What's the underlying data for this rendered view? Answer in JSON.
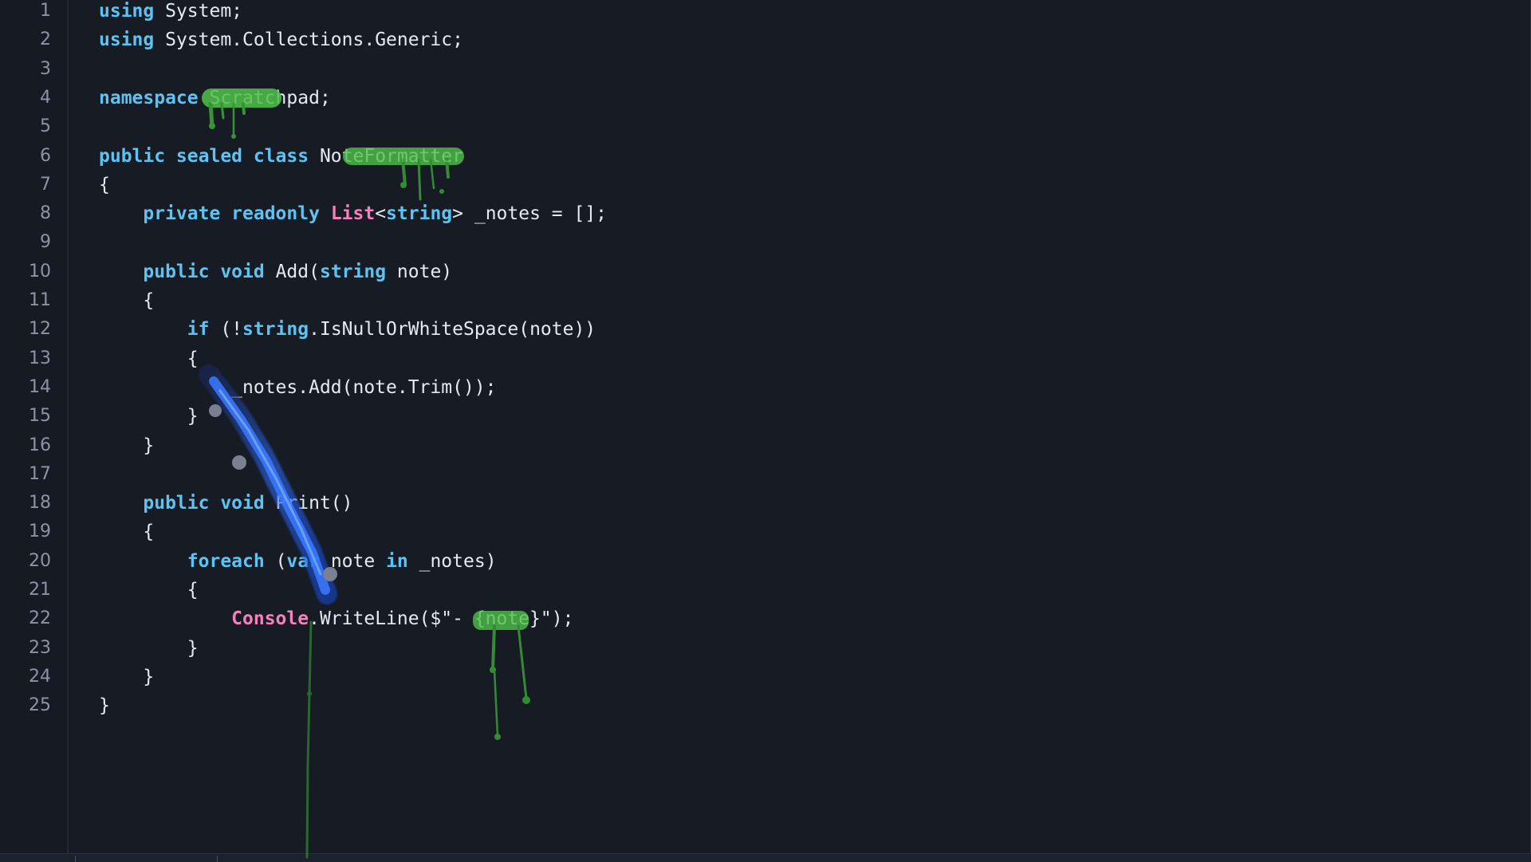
{
  "editor": {
    "lines": [
      {
        "num": "1",
        "tokens": [
          {
            "t": "using",
            "c": "kw"
          },
          {
            "t": " System;",
            "c": "plain"
          }
        ]
      },
      {
        "num": "2",
        "tokens": [
          {
            "t": "using",
            "c": "kw"
          },
          {
            "t": " System.Collections.Generic;",
            "c": "plain"
          }
        ]
      },
      {
        "num": "3",
        "tokens": []
      },
      {
        "num": "4",
        "tokens": [
          {
            "t": "namespace",
            "c": "kw"
          },
          {
            "t": " Scratchpad;",
            "c": "plain"
          }
        ]
      },
      {
        "num": "5",
        "tokens": []
      },
      {
        "num": "6",
        "tokens": [
          {
            "t": "public sealed class",
            "c": "kw"
          },
          {
            "t": " NoteFormatter",
            "c": "plain"
          }
        ]
      },
      {
        "num": "7",
        "tokens": [
          {
            "t": "{",
            "c": "plain"
          }
        ]
      },
      {
        "num": "8",
        "tokens": [
          {
            "t": "    ",
            "c": "plain"
          },
          {
            "t": "private readonly",
            "c": "kw"
          },
          {
            "t": " ",
            "c": "plain"
          },
          {
            "t": "List",
            "c": "type"
          },
          {
            "t": "<",
            "c": "plain"
          },
          {
            "t": "string",
            "c": "kw"
          },
          {
            "t": "> _notes = [];",
            "c": "plain"
          }
        ]
      },
      {
        "num": "9",
        "tokens": []
      },
      {
        "num": "10",
        "tokens": [
          {
            "t": "    ",
            "c": "plain"
          },
          {
            "t": "public void",
            "c": "kw"
          },
          {
            "t": " Add(",
            "c": "plain"
          },
          {
            "t": "string",
            "c": "kw"
          },
          {
            "t": " note)",
            "c": "plain"
          }
        ]
      },
      {
        "num": "11",
        "tokens": [
          {
            "t": "    {",
            "c": "plain"
          }
        ]
      },
      {
        "num": "12",
        "tokens": [
          {
            "t": "        ",
            "c": "plain"
          },
          {
            "t": "if",
            "c": "kw"
          },
          {
            "t": " (!",
            "c": "plain"
          },
          {
            "t": "string",
            "c": "kw"
          },
          {
            "t": ".IsNullOrWhiteSpace(note))",
            "c": "plain"
          }
        ]
      },
      {
        "num": "13",
        "tokens": [
          {
            "t": "        {",
            "c": "plain"
          }
        ]
      },
      {
        "num": "14",
        "tokens": [
          {
            "t": "            _notes.Add(note.Trim());",
            "c": "plain"
          }
        ]
      },
      {
        "num": "15",
        "tokens": [
          {
            "t": "        }",
            "c": "plain"
          }
        ]
      },
      {
        "num": "16",
        "tokens": [
          {
            "t": "    }",
            "c": "plain"
          }
        ]
      },
      {
        "num": "17",
        "tokens": []
      },
      {
        "num": "18",
        "tokens": [
          {
            "t": "    ",
            "c": "plain"
          },
          {
            "t": "public void",
            "c": "kw"
          },
          {
            "t": " Print()",
            "c": "plain"
          }
        ]
      },
      {
        "num": "19",
        "tokens": [
          {
            "t": "    {",
            "c": "plain"
          }
        ]
      },
      {
        "num": "20",
        "tokens": [
          {
            "t": "        ",
            "c": "plain"
          },
          {
            "t": "foreach",
            "c": "kw"
          },
          {
            "t": " (",
            "c": "plain"
          },
          {
            "t": "var",
            "c": "kw"
          },
          {
            "t": " note ",
            "c": "plain"
          },
          {
            "t": "in",
            "c": "kw"
          },
          {
            "t": " _notes)",
            "c": "plain"
          }
        ]
      },
      {
        "num": "21",
        "tokens": [
          {
            "t": "        {",
            "c": "plain"
          }
        ]
      },
      {
        "num": "22",
        "tokens": [
          {
            "t": "            ",
            "c": "plain"
          },
          {
            "t": "Console",
            "c": "type"
          },
          {
            "t": ".WriteLine($\"- {note}\");",
            "c": "plain"
          }
        ]
      },
      {
        "num": "23",
        "tokens": [
          {
            "t": "        }",
            "c": "plain"
          }
        ]
      },
      {
        "num": "24",
        "tokens": [
          {
            "t": "    }",
            "c": "plain"
          }
        ]
      },
      {
        "num": "25",
        "tokens": [
          {
            "t": "}",
            "c": "plain"
          }
        ]
      }
    ]
  },
  "colors": {
    "background": "#161b24",
    "gutter": "#151a23",
    "keyword": "#5cc3f2",
    "type": "#f77fbe",
    "text": "#e6e9ef",
    "line_number": "#8b94a6",
    "paint_green": "#5fd35a",
    "paint_blue": "#2f6dff"
  }
}
